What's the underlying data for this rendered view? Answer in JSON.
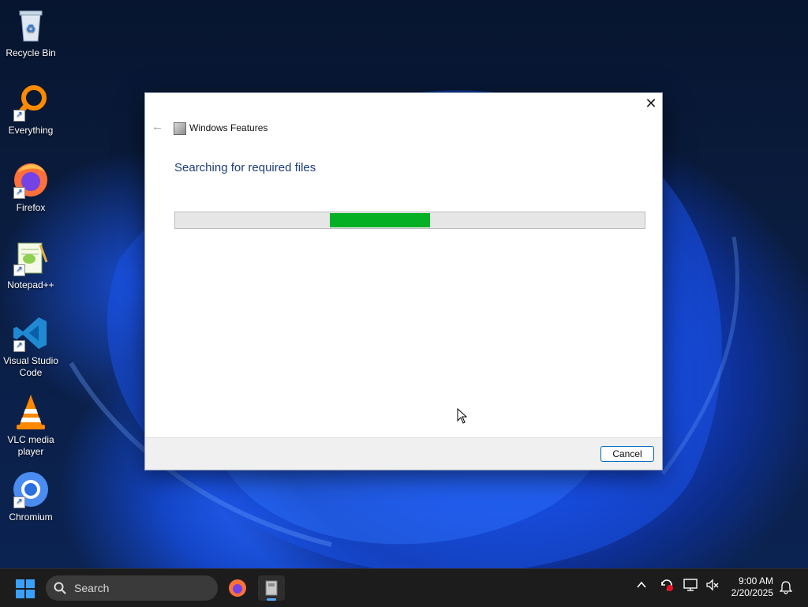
{
  "desktop": {
    "icons": [
      {
        "label": "Recycle Bin",
        "icon": "recycle-bin-icon"
      },
      {
        "label": "Everything",
        "icon": "everything-search-icon"
      },
      {
        "label": "Firefox",
        "icon": "firefox-icon"
      },
      {
        "label": "Notepad++",
        "icon": "notepad-plus-plus-icon"
      },
      {
        "label": "Visual Studio Code",
        "icon": "vscode-icon"
      },
      {
        "label": "VLC media player",
        "icon": "vlc-icon"
      },
      {
        "label": "Chromium",
        "icon": "chromium-icon"
      }
    ]
  },
  "dialog": {
    "title": "Windows Features",
    "close_glyph": "✕",
    "back_glyph": "←",
    "heading": "Searching for required files",
    "progress": {
      "state": "indeterminate (marquee)",
      "color": "#06b025"
    },
    "cancel_label": "Cancel"
  },
  "taskbar": {
    "search_label": "Search",
    "pinned": [
      {
        "name": "Firefox",
        "icon": "firefox-icon"
      },
      {
        "name": "Windows Features",
        "icon": "windows-features-icon",
        "active": true
      }
    ],
    "tray": {
      "chevron": "^",
      "icons": [
        "update-alert-icon",
        "display-network-icon",
        "volume-muted-icon"
      ]
    },
    "clock": {
      "time": "9:00 AM",
      "date": "2/20/2025"
    },
    "notification_icon": "bell-icon"
  },
  "colors": {
    "accent": "#0067c0",
    "progress": "#06b025",
    "heading": "#1c3d7a"
  }
}
